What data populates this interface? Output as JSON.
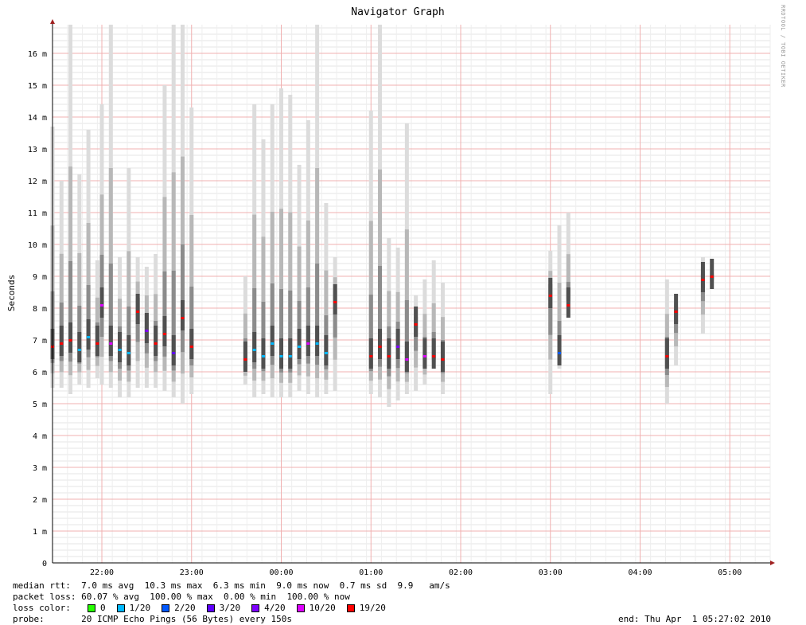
{
  "window": {
    "title": "Navigator Graph",
    "watermark": "RRDTOOL / TOBI OETIKER"
  },
  "chart_data": {
    "type": "area",
    "title": "Navigator Graph",
    "ylabel": "Seconds",
    "xlabel": "",
    "y_unit": "m",
    "ylim": [
      0,
      16.9
    ],
    "yticks": [
      {
        "v": 0,
        "label": "0"
      },
      {
        "v": 1,
        "label": "1 m"
      },
      {
        "v": 2,
        "label": "2 m"
      },
      {
        "v": 3,
        "label": "3 m"
      },
      {
        "v": 4,
        "label": "4 m"
      },
      {
        "v": 5,
        "label": "5 m"
      },
      {
        "v": 6,
        "label": "6 m"
      },
      {
        "v": 7,
        "label": "7 m"
      },
      {
        "v": 8,
        "label": "8 m"
      },
      {
        "v": 9,
        "label": "9 m"
      },
      {
        "v": 10,
        "label": "10 m"
      },
      {
        "v": 11,
        "label": "11 m"
      },
      {
        "v": 12,
        "label": "12 m"
      },
      {
        "v": 13,
        "label": "13 m"
      },
      {
        "v": 14,
        "label": "14 m"
      },
      {
        "v": 15,
        "label": "15 m"
      },
      {
        "v": 16,
        "label": "16 m"
      }
    ],
    "xlim": [
      "21:27",
      "05:27"
    ],
    "xticks": [
      "22:00",
      "23:00",
      "00:00",
      "01:00",
      "02:00",
      "03:00",
      "04:00",
      "05:00"
    ],
    "grid": true,
    "series": [
      {
        "role": "median rtt",
        "points": [
          {
            "x": "21:27",
            "y": 6.8,
            "spread": [
              5.5,
              13.7
            ],
            "loss": "19/20"
          },
          {
            "x": "21:33",
            "y": 6.9,
            "spread": [
              5.5,
              12.0
            ],
            "loss": "19/20"
          },
          {
            "x": "21:39",
            "y": 7.0,
            "spread": [
              5.3,
              16.9
            ],
            "loss": "19/20"
          },
          {
            "x": "21:45",
            "y": 6.7,
            "spread": [
              5.6,
              12.2
            ],
            "loss": "1/20"
          },
          {
            "x": "21:51",
            "y": 7.1,
            "spread": [
              5.5,
              13.6
            ],
            "loss": "1/20"
          },
          {
            "x": "21:57",
            "y": 6.9,
            "spread": [
              5.8,
              9.5
            ],
            "loss": "19/20"
          },
          {
            "x": "22:00",
            "y": 8.1,
            "spread": [
              5.6,
              14.4
            ],
            "loss": "10/20"
          },
          {
            "x": "22:06",
            "y": 6.9,
            "spread": [
              5.5,
              16.9
            ],
            "loss": "10/20"
          },
          {
            "x": "22:12",
            "y": 6.7,
            "spread": [
              5.2,
              9.6
            ],
            "loss": "1/20"
          },
          {
            "x": "22:18",
            "y": 6.6,
            "spread": [
              5.2,
              12.4
            ],
            "loss": "1/20"
          },
          {
            "x": "22:24",
            "y": 7.9,
            "spread": [
              5.5,
              9.6
            ],
            "loss": "19/20"
          },
          {
            "x": "22:30",
            "y": 7.3,
            "spread": [
              5.5,
              9.3
            ],
            "loss": "4/20"
          },
          {
            "x": "22:36",
            "y": 6.9,
            "spread": [
              5.5,
              9.7
            ],
            "loss": "19/20"
          },
          {
            "x": "22:42",
            "y": 7.2,
            "spread": [
              5.4,
              15.0
            ],
            "loss": "19/20"
          },
          {
            "x": "22:48",
            "y": 6.6,
            "spread": [
              5.2,
              16.9
            ],
            "loss": "3/20"
          },
          {
            "x": "22:54",
            "y": 7.7,
            "spread": [
              5.0,
              16.9
            ],
            "loss": "19/20"
          },
          {
            "x": "23:00",
            "y": 6.8,
            "spread": [
              5.3,
              14.3
            ],
            "loss": "19/20"
          },
          {
            "x": "23:36",
            "y": 6.4,
            "spread": [
              5.6,
              9.0
            ],
            "loss": "19/20"
          },
          {
            "x": "23:42",
            "y": 6.7,
            "spread": [
              5.2,
              14.4
            ],
            "loss": "1/20"
          },
          {
            "x": "23:48",
            "y": 6.5,
            "spread": [
              5.3,
              13.3
            ],
            "loss": "1/20"
          },
          {
            "x": "23:54",
            "y": 6.9,
            "spread": [
              5.2,
              14.4
            ],
            "loss": "1/20"
          },
          {
            "x": "00:00",
            "y": 6.5,
            "spread": [
              5.2,
              14.9
            ],
            "loss": "1/20"
          },
          {
            "x": "00:06",
            "y": 6.5,
            "spread": [
              5.2,
              14.7
            ],
            "loss": "1/20"
          },
          {
            "x": "00:12",
            "y": 6.8,
            "spread": [
              5.4,
              12.5
            ],
            "loss": "1/20"
          },
          {
            "x": "00:18",
            "y": 6.9,
            "spread": [
              5.3,
              13.9
            ],
            "loss": "10/20"
          },
          {
            "x": "00:24",
            "y": 6.9,
            "spread": [
              5.2,
              16.9
            ],
            "loss": "1/20"
          },
          {
            "x": "00:30",
            "y": 6.6,
            "spread": [
              5.3,
              11.3
            ],
            "loss": "1/20"
          },
          {
            "x": "00:36",
            "y": 8.2,
            "spread": [
              5.4,
              9.6
            ],
            "loss": "19/20"
          },
          {
            "x": "01:00",
            "y": 6.5,
            "spread": [
              5.3,
              14.2
            ],
            "loss": "19/20"
          },
          {
            "x": "01:06",
            "y": 6.8,
            "spread": [
              5.2,
              16.9
            ],
            "loss": "19/20"
          },
          {
            "x": "01:12",
            "y": 6.5,
            "spread": [
              4.9,
              10.2
            ],
            "loss": "19/20"
          },
          {
            "x": "01:18",
            "y": 6.8,
            "spread": [
              5.1,
              9.9
            ],
            "loss": "4/20"
          },
          {
            "x": "01:24",
            "y": 6.4,
            "spread": [
              5.3,
              13.8
            ],
            "loss": "10/20"
          },
          {
            "x": "01:30",
            "y": 7.5,
            "spread": [
              5.4,
              8.4
            ],
            "loss": "19/20"
          },
          {
            "x": "01:36",
            "y": 6.5,
            "spread": [
              5.6,
              8.9
            ],
            "loss": "10/20"
          },
          {
            "x": "01:42",
            "y": 6.5,
            "spread": [
              6.3,
              9.5
            ],
            "loss": "19/20"
          },
          {
            "x": "01:48",
            "y": 6.4,
            "spread": [
              5.3,
              8.8
            ],
            "loss": "19/20"
          },
          {
            "x": "03:00",
            "y": 8.4,
            "spread": [
              5.3,
              9.8
            ],
            "loss": "19/20"
          },
          {
            "x": "03:06",
            "y": 6.6,
            "spread": [
              6.1,
              10.6
            ],
            "loss": "2/20"
          },
          {
            "x": "03:12",
            "y": 8.1,
            "spread": [
              8.4,
              11.0
            ],
            "loss": "19/20"
          },
          {
            "x": "04:18",
            "y": 6.5,
            "spread": [
              5.0,
              8.9
            ],
            "loss": "19/20"
          },
          {
            "x": "04:24",
            "y": 7.9,
            "spread": [
              6.2,
              8.2
            ],
            "loss": "19/20"
          },
          {
            "x": "04:42",
            "y": 8.9,
            "spread": [
              7.2,
              9.6
            ],
            "loss": "19/20"
          },
          {
            "x": "04:48",
            "y": 9.0,
            "spread": [
              8.8,
              9.1
            ],
            "loss": "19/20"
          }
        ]
      }
    ],
    "legend": {
      "median_rtt": {
        "label": "median rtt:",
        "items": [
          "7.0 ms avg",
          "10.3 ms max",
          "6.3 ms min",
          "9.0 ms now",
          "0.7 ms sd",
          "9.9   am/s"
        ]
      },
      "packet_loss": {
        "label": "packet loss:",
        "items": [
          "60.07 % avg",
          "100.00 % max",
          "0.00 % min",
          "100.00 % now"
        ]
      },
      "loss_color": {
        "label": "loss color:",
        "items": [
          {
            "label": "0",
            "color": "#26ff00"
          },
          {
            "label": "1/20",
            "color": "#00b8ff"
          },
          {
            "label": "2/20",
            "color": "#0059ff"
          },
          {
            "label": "3/20",
            "color": "#5e00ff"
          },
          {
            "label": "4/20",
            "color": "#7e00ff"
          },
          {
            "label": "10/20",
            "color": "#dd00ff"
          },
          {
            "label": "19/20",
            "color": "#ff0000"
          }
        ]
      },
      "probe": {
        "label": "probe:",
        "text": "20 ICMP Echo Pings (56 Bytes) every 150s"
      },
      "end": {
        "text": "end: Thu Apr  1 05:27:02 2010"
      }
    }
  }
}
